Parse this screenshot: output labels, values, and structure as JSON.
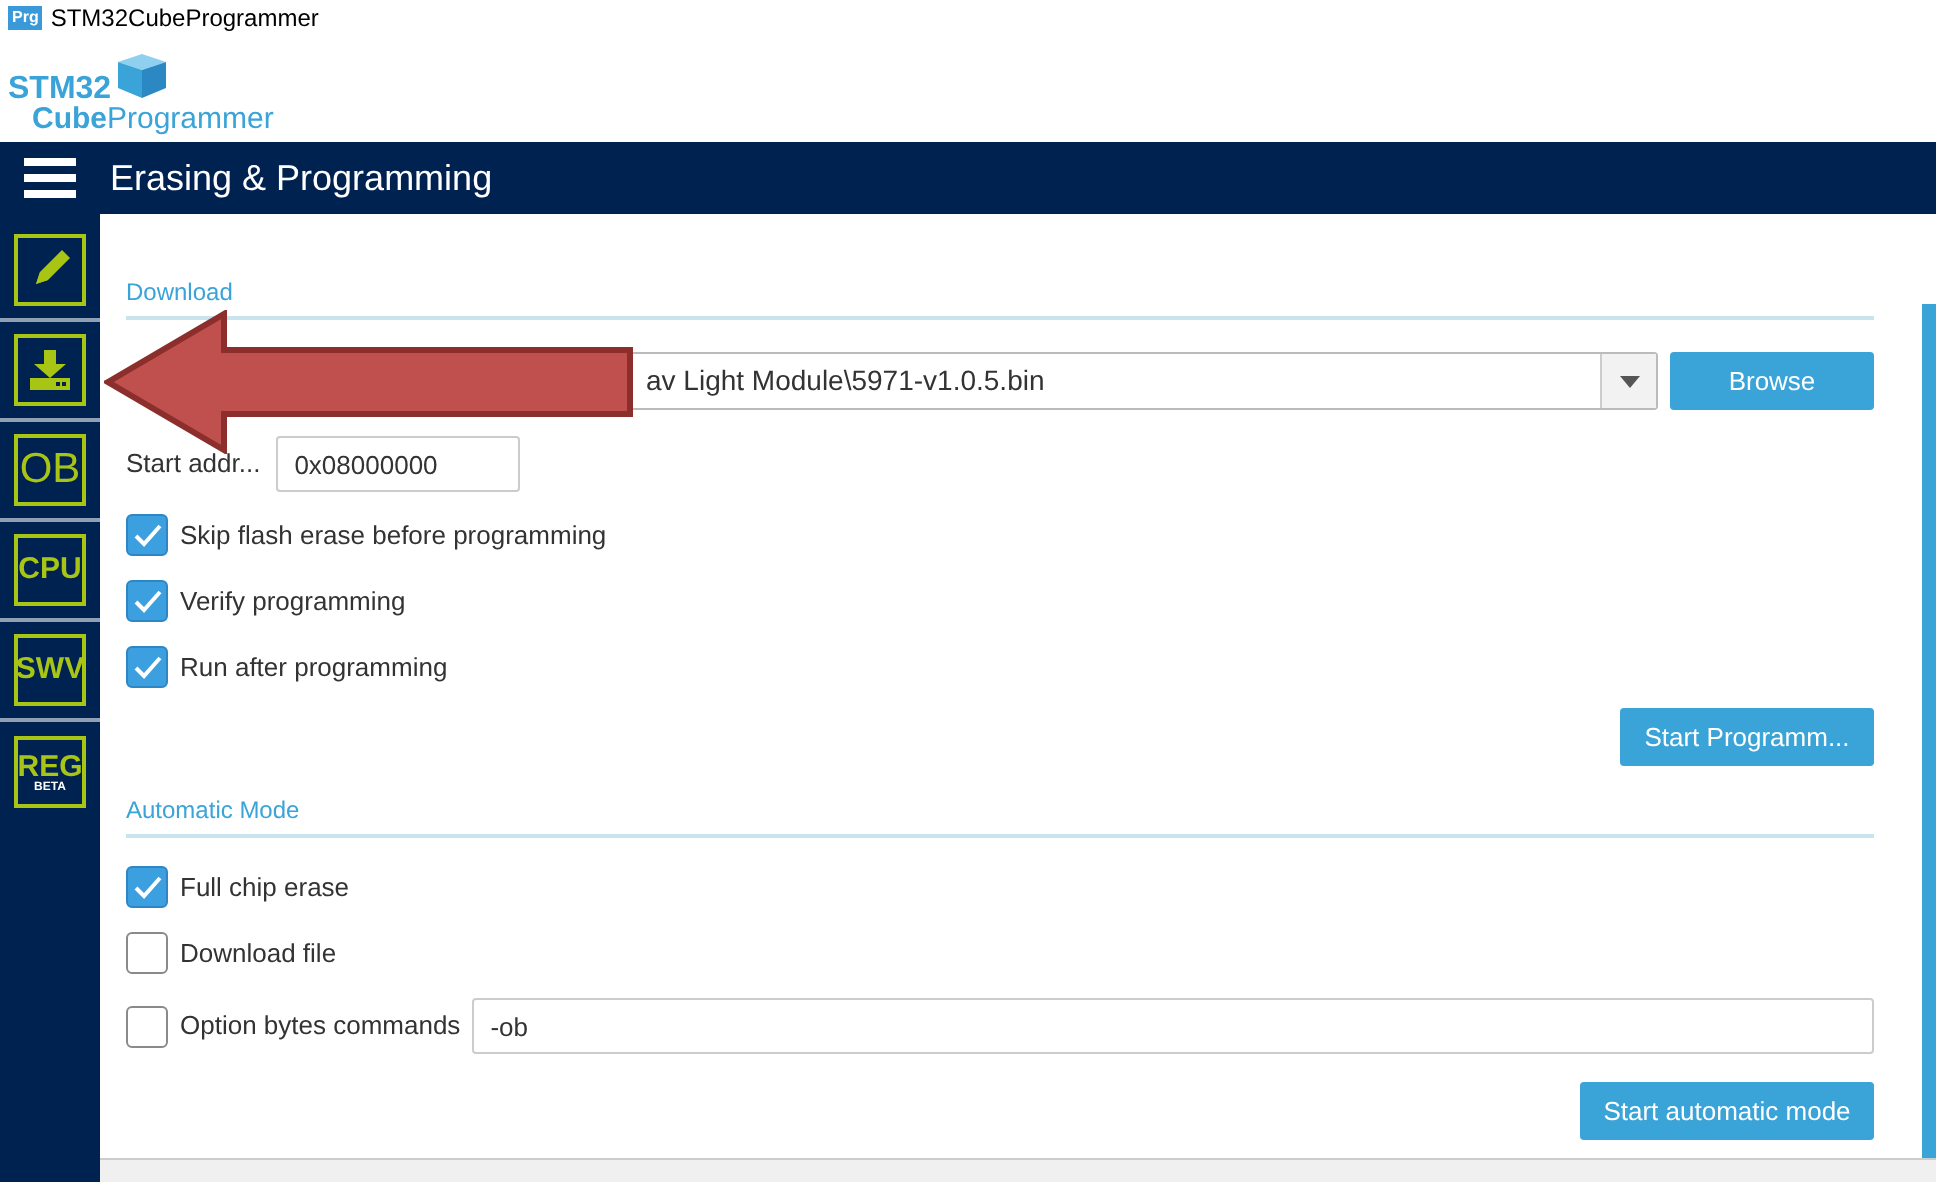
{
  "window": {
    "icon_text": "Prg",
    "title": "STM32CubeProgrammer"
  },
  "logo": {
    "line1": "STM32",
    "line2_bold": "Cube",
    "line2": "Programmer"
  },
  "header": {
    "title": "Erasing & Programming"
  },
  "sidebar": {
    "items": [
      {
        "kind": "pencil",
        "selected": false
      },
      {
        "kind": "download",
        "selected": false
      },
      {
        "kind": "text",
        "label": "OB",
        "selected": false
      },
      {
        "kind": "text",
        "label": "CPU",
        "selected": false
      },
      {
        "kind": "text",
        "label": "SWV",
        "selected": false
      },
      {
        "kind": "beta",
        "label": "REG",
        "sub": "BETA",
        "selected": false
      }
    ]
  },
  "download": {
    "title": "Download",
    "file_path": {
      "value": "av Light Module\\5971-v1.0.5.bin"
    },
    "browse_button": "Browse",
    "start_address": {
      "label": "Start addr...",
      "value": "0x08000000"
    },
    "options": [
      {
        "label": "Skip flash erase before programming",
        "checked": true
      },
      {
        "label": "Verify programming",
        "checked": true
      },
      {
        "label": "Run after programming",
        "checked": true
      }
    ],
    "start_button": "Start Programm..."
  },
  "automatic_mode": {
    "title": "Automatic Mode",
    "options": [
      {
        "label": "Full chip erase",
        "checked": true
      },
      {
        "label": "Download file",
        "checked": false
      },
      {
        "label": "Option bytes commands",
        "checked": false,
        "value": "-ob"
      }
    ],
    "start_button": "Start automatic mode"
  },
  "annotation": {
    "kind": "arrow"
  }
}
